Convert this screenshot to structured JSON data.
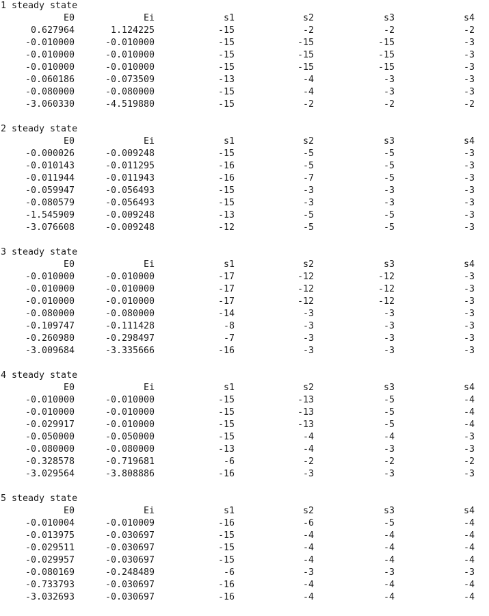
{
  "columns": [
    "E0",
    "Ei",
    "s1",
    "s2",
    "s3",
    "s4"
  ],
  "blocks": [
    {
      "title": "1 steady state",
      "rows": [
        [
          "0.627964",
          "1.124225",
          "-15",
          "-2",
          "-2",
          "-2"
        ],
        [
          "-0.010000",
          "-0.010000",
          "-15",
          "-15",
          "-15",
          "-3"
        ],
        [
          "-0.010000",
          "-0.010000",
          "-15",
          "-15",
          "-15",
          "-3"
        ],
        [
          "-0.010000",
          "-0.010000",
          "-15",
          "-15",
          "-15",
          "-3"
        ],
        [
          "-0.060186",
          "-0.073509",
          "-13",
          "-4",
          "-3",
          "-3"
        ],
        [
          "-0.080000",
          "-0.080000",
          "-15",
          "-4",
          "-3",
          "-3"
        ],
        [
          "-3.060330",
          "-4.519880",
          "-15",
          "-2",
          "-2",
          "-2"
        ]
      ]
    },
    {
      "title": "2 steady state",
      "rows": [
        [
          "-0.000026",
          "-0.009248",
          "-15",
          "-5",
          "-5",
          "-3"
        ],
        [
          "-0.010143",
          "-0.011295",
          "-16",
          "-5",
          "-5",
          "-3"
        ],
        [
          "-0.011944",
          "-0.011943",
          "-16",
          "-7",
          "-5",
          "-3"
        ],
        [
          "-0.059947",
          "-0.056493",
          "-15",
          "-3",
          "-3",
          "-3"
        ],
        [
          "-0.080579",
          "-0.056493",
          "-15",
          "-3",
          "-3",
          "-3"
        ],
        [
          "-1.545909",
          "-0.009248",
          "-13",
          "-5",
          "-5",
          "-3"
        ],
        [
          "-3.076608",
          "-0.009248",
          "-12",
          "-5",
          "-5",
          "-3"
        ]
      ]
    },
    {
      "title": "3 steady state",
      "rows": [
        [
          "-0.010000",
          "-0.010000",
          "-17",
          "-12",
          "-12",
          "-3"
        ],
        [
          "-0.010000",
          "-0.010000",
          "-17",
          "-12",
          "-12",
          "-3"
        ],
        [
          "-0.010000",
          "-0.010000",
          "-17",
          "-12",
          "-12",
          "-3"
        ],
        [
          "-0.080000",
          "-0.080000",
          "-14",
          "-3",
          "-3",
          "-3"
        ],
        [
          "-0.109747",
          "-0.111428",
          "-8",
          "-3",
          "-3",
          "-3"
        ],
        [
          "-0.260980",
          "-0.298497",
          "-7",
          "-3",
          "-3",
          "-3"
        ],
        [
          "-3.009684",
          "-3.335666",
          "-16",
          "-3",
          "-3",
          "-3"
        ]
      ]
    },
    {
      "title": "4 steady state",
      "rows": [
        [
          "-0.010000",
          "-0.010000",
          "-15",
          "-13",
          "-5",
          "-4"
        ],
        [
          "-0.010000",
          "-0.010000",
          "-15",
          "-13",
          "-5",
          "-4"
        ],
        [
          "-0.029917",
          "-0.010000",
          "-15",
          "-13",
          "-5",
          "-4"
        ],
        [
          "-0.050000",
          "-0.050000",
          "-15",
          "-4",
          "-4",
          "-3"
        ],
        [
          "-0.080000",
          "-0.080000",
          "-13",
          "-4",
          "-3",
          "-3"
        ],
        [
          "-0.328578",
          "-0.719681",
          "-6",
          "-2",
          "-2",
          "-2"
        ],
        [
          "-3.029564",
          "-3.808886",
          "-16",
          "-3",
          "-3",
          "-3"
        ]
      ]
    },
    {
      "title": "5 steady state",
      "rows": [
        [
          "-0.010004",
          "-0.010009",
          "-16",
          "-6",
          "-5",
          "-4"
        ],
        [
          "-0.013975",
          "-0.030697",
          "-15",
          "-4",
          "-4",
          "-4"
        ],
        [
          "-0.029511",
          "-0.030697",
          "-15",
          "-4",
          "-4",
          "-4"
        ],
        [
          "-0.029957",
          "-0.030697",
          "-15",
          "-4",
          "-4",
          "-4"
        ],
        [
          "-0.080169",
          "-0.248489",
          "-6",
          "-3",
          "-3",
          "-3"
        ],
        [
          "-0.733793",
          "-0.030697",
          "-16",
          "-4",
          "-4",
          "-4"
        ],
        [
          "-3.032693",
          "-0.030697",
          "-16",
          "-4",
          "-4",
          "-4"
        ]
      ]
    }
  ]
}
